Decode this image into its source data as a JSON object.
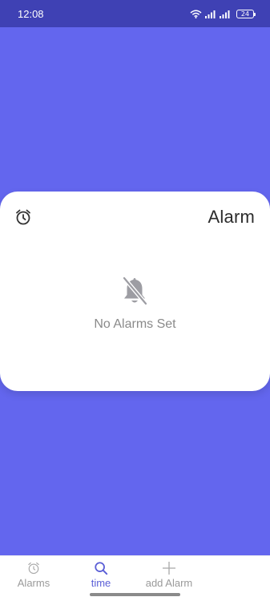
{
  "status_bar": {
    "time": "12:08",
    "battery": "24"
  },
  "card": {
    "title": "Alarm",
    "empty_message": "No Alarms Set"
  },
  "bottom_nav": {
    "items": [
      {
        "label": "Alarms",
        "icon": "alarm-clock-icon"
      },
      {
        "label": "time",
        "icon": "search-icon",
        "active": true
      },
      {
        "label": "add Alarm",
        "icon": "plus-icon"
      }
    ]
  },
  "colors": {
    "background": "#6366EE",
    "status_bar": "#3F41B4",
    "active_nav": "#5b5fd6"
  }
}
